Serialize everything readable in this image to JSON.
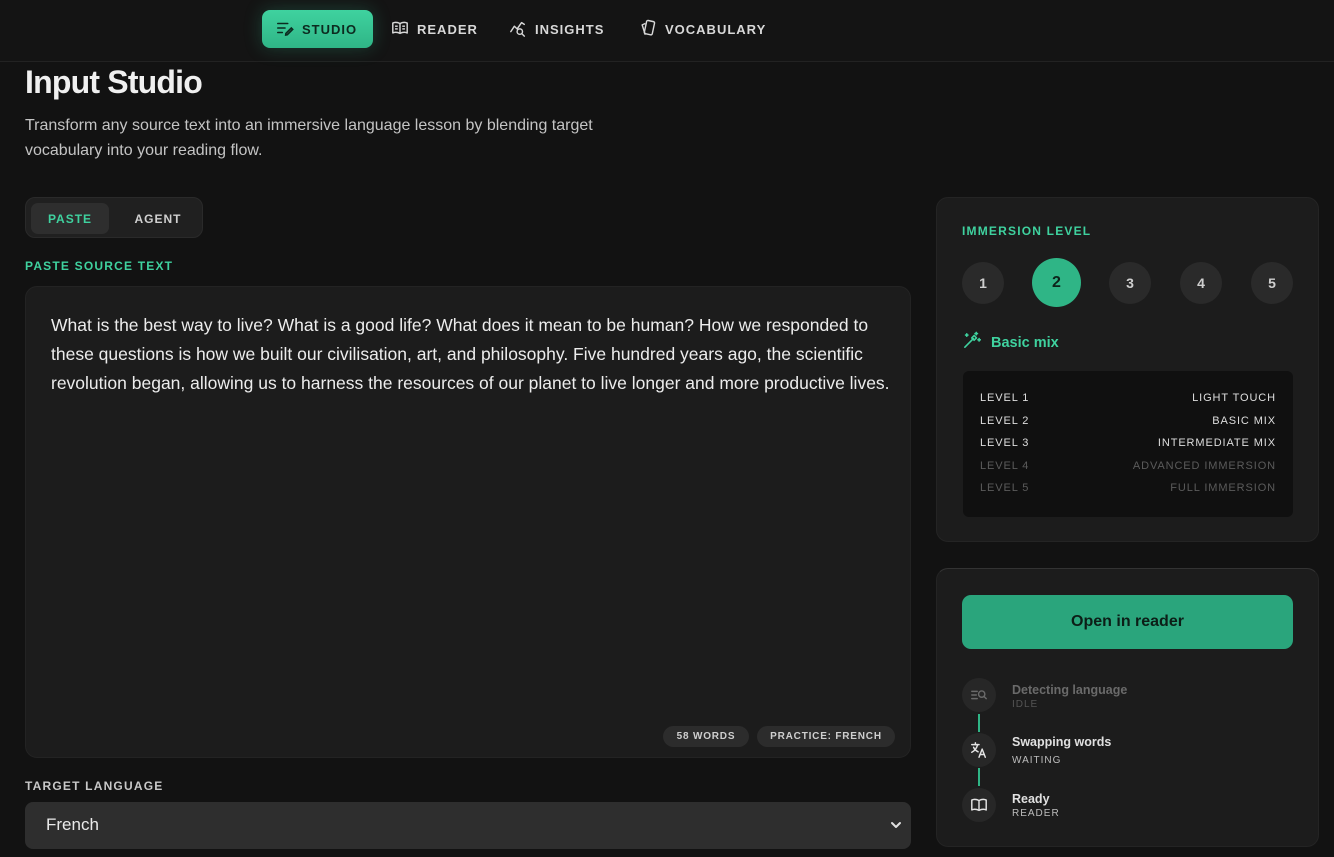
{
  "nav": {
    "items": [
      {
        "label": "STUDIO",
        "icon": "studio-edit-icon"
      },
      {
        "label": "READER",
        "icon": "book-open-icon"
      },
      {
        "label": "INSIGHTS",
        "icon": "insights-chart-icon"
      },
      {
        "label": "VOCABULARY",
        "icon": "cards-icon"
      }
    ],
    "active": "STUDIO"
  },
  "header": {
    "title": "Input Studio",
    "subtitle": "Transform any source text into an immersive language lesson by blending target vocabulary into your reading flow."
  },
  "mode_tabs": {
    "paste": "PASTE",
    "agent": "AGENT",
    "active": "PASTE"
  },
  "editor": {
    "label": "PASTE SOURCE TEXT",
    "text": "What is the best way to live? What is a good life? What does it mean to be human? How we responded to these questions is how we built our civilisation, art, and philosophy. Five hundred years ago, the scientific revolution began, allowing us to harness the resources of our planet to live longer and more productive lives.",
    "word_count": "58 WORDS",
    "practice": "PRACTICE: FRENCH"
  },
  "target_language": {
    "label": "TARGET LANGUAGE",
    "value": "French"
  },
  "immersion": {
    "label": "IMMERSION LEVEL",
    "levels": [
      "1",
      "2",
      "3",
      "4",
      "5"
    ],
    "selected": "2",
    "mode_name": "Basic mix",
    "table": [
      {
        "level": "LEVEL 1",
        "name": "LIGHT TOUCH",
        "available": true
      },
      {
        "level": "LEVEL 2",
        "name": "BASIC MIX",
        "available": true
      },
      {
        "level": "LEVEL 3",
        "name": "INTERMEDIATE MIX",
        "available": true
      },
      {
        "level": "LEVEL 4",
        "name": "ADVANCED IMMERSION",
        "available": false
      },
      {
        "level": "LEVEL 5",
        "name": "FULL IMMERSION",
        "available": false
      }
    ]
  },
  "action": {
    "button": "Open in reader",
    "steps": [
      {
        "title": "Detecting language",
        "status": "IDLE",
        "icon": "detect-search-icon"
      },
      {
        "title": "Swapping words",
        "status": "WAITING",
        "icon": "translate-icon"
      },
      {
        "title": "Ready",
        "status": "READER",
        "icon": "book-open-icon"
      }
    ]
  },
  "colors": {
    "accent": "#3fd29f",
    "accent_dark": "#2aa57c",
    "background": "#121212",
    "panel": "#1c1c1c"
  }
}
